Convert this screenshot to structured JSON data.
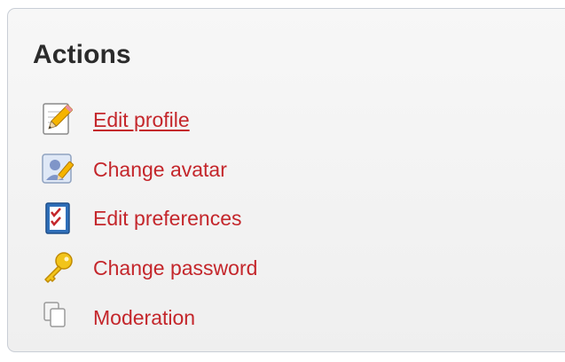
{
  "panel": {
    "title": "Actions",
    "items": [
      {
        "label": "Edit profile",
        "icon": "pencil-icon",
        "active": true
      },
      {
        "label": "Change avatar",
        "icon": "avatar-icon",
        "active": false
      },
      {
        "label": "Edit preferences",
        "icon": "checklist-icon",
        "active": false
      },
      {
        "label": "Change password",
        "icon": "key-icon",
        "active": false
      },
      {
        "label": "Moderation",
        "icon": "documents-icon",
        "active": false
      }
    ]
  },
  "colors": {
    "link": "#c4262b",
    "title": "#2b2b2b",
    "panel_border": "#c9ced6",
    "panel_background": "#f3f3f3"
  }
}
